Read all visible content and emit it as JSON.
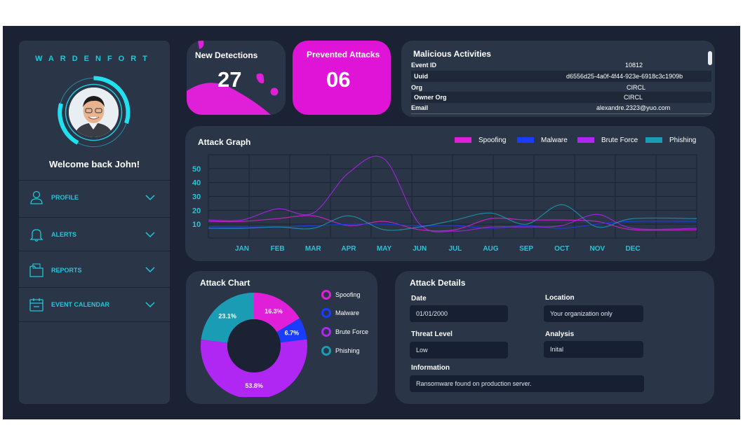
{
  "brand": "WARDENFORT",
  "user": {
    "welcome": "Welcome back John!"
  },
  "menu": [
    {
      "label": "PROFILE",
      "icon": "user-icon"
    },
    {
      "label": "ALERTS",
      "icon": "bell-icon"
    },
    {
      "label": "REPORTS",
      "icon": "folder-icon"
    },
    {
      "label": "EVENT CALENDAR",
      "icon": "calendar-icon"
    }
  ],
  "new_detections": {
    "title": "New Detections",
    "value": "27"
  },
  "prevented": {
    "title": "Prevented Attacks",
    "value": "06"
  },
  "malicious": {
    "title": "Malicious Activities",
    "rows": [
      {
        "key": "Event ID",
        "value": "10812"
      },
      {
        "key": "Uuid",
        "value": "d6556d25-4a0f-4f44-923e-6918c3c1909b"
      },
      {
        "key": "Org",
        "value": "CIRCL"
      },
      {
        "key": "Owner Org",
        "value": "CIRCL"
      },
      {
        "key": "Email",
        "value": "alexandre.2323@yuo.com"
      }
    ]
  },
  "colors": {
    "spoofing": "#e020d8",
    "malware": "#1a3cff",
    "brute_force": "#b026f2",
    "phishing": "#1a9db4",
    "accent": "#21c7d8"
  },
  "chart_data": [
    {
      "type": "line",
      "title": "Attack Graph",
      "categories": [
        "JAN",
        "FEB",
        "MAR",
        "APR",
        "MAY",
        "JUN",
        "JUL",
        "AUG",
        "SEP",
        "OCT",
        "NOV",
        "DEC"
      ],
      "yticks": [
        10,
        20,
        30,
        40,
        50
      ],
      "ylim": [
        0,
        60
      ],
      "grid": true,
      "legend": "top-right",
      "series": [
        {
          "name": "Spoofing",
          "values": [
            12,
            14,
            16,
            9,
            12,
            6,
            6,
            14,
            13,
            13,
            12,
            6
          ]
        },
        {
          "name": "Malware",
          "values": [
            8,
            8,
            9,
            10,
            10,
            9,
            9,
            7,
            9,
            7,
            10,
            12
          ]
        },
        {
          "name": "Brute Force",
          "values": [
            13,
            21,
            18,
            47,
            57,
            10,
            5,
            8,
            8,
            9,
            17,
            7
          ]
        },
        {
          "name": "Phishing",
          "values": [
            7,
            8,
            7,
            16,
            6,
            8,
            13,
            18,
            10,
            24,
            8,
            14
          ]
        }
      ]
    },
    {
      "type": "pie",
      "title": "Attack Chart",
      "legend": "right",
      "slices": [
        {
          "name": "Spoofing",
          "value": 16.3,
          "label": "16.3%"
        },
        {
          "name": "Malware",
          "value": 6.7,
          "label": "6.7%"
        },
        {
          "name": "Brute Force",
          "value": 53.8,
          "label": "53.8%"
        },
        {
          "name": "Phishing",
          "value": 23.1,
          "label": "23.1%"
        }
      ]
    }
  ],
  "details": {
    "title": "Attack Details",
    "date_label": "Date",
    "date": "01/01/2000",
    "location_label": "Location",
    "location": "Your organization only",
    "threat_label": "Threat Level",
    "threat": "Low",
    "analysis_label": "Analysis",
    "analysis": "Inital",
    "info_label": "Information",
    "info": "Ransomware found on production server."
  }
}
